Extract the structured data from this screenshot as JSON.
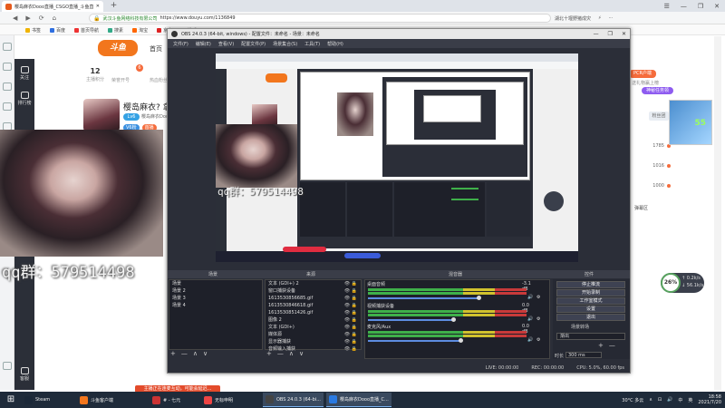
{
  "browser": {
    "tab_title": "樱岛麻衣Dooo直播_CSGO直播_斗鱼直播",
    "new_tab": "+",
    "window_controls": [
      "☰",
      "—",
      "❐",
      "✕"
    ],
    "nav": [
      "◀",
      "▶",
      "⟳",
      "⌂"
    ],
    "url_site": "武汉斗鱼网络科技有限公司",
    "url": "https://www.douyu.com/1136849",
    "right_tools": [
      "湖北十堰野猪成灾",
      "⚡",
      "⋯"
    ],
    "bookmarks": [
      {
        "label": "书签",
        "color": "#f0b400"
      },
      {
        "label": "百度",
        "color": "#2f6fe0"
      },
      {
        "label": "首页导航",
        "color": "#e33"
      },
      {
        "label": "搜素",
        "color": "#3a8"
      },
      {
        "label": "淘宝",
        "color": "#f60"
      },
      {
        "label": "京东",
        "color": "#d22"
      },
      {
        "label": "游戏",
        "color": "#66c"
      }
    ]
  },
  "douyu": {
    "logo": "斗鱼",
    "home": "首页",
    "sidebar": [
      {
        "label": "关注"
      },
      {
        "label": "排行榜"
      },
      {
        "label": "客服"
      }
    ],
    "stats": [
      {
        "value": "12",
        "label": "主播积分"
      },
      {
        "value": "",
        "label": "荣誉开号"
      },
      {
        "value": "",
        "label": "热血粉丝"
      }
    ],
    "stat_badge": "6",
    "streamer_title": "樱岛麻衣? 拿来",
    "level_badge": "Lv6",
    "streamer_name": "樱岛麻衣Dooo",
    "tags": [
      {
        "text": "V6粉",
        "color": "#3b90e0"
      },
      {
        "text": "首播",
        "color": "#f56c3c"
      }
    ],
    "pcr": "PCR户端",
    "gift": "送礼物赢上榜",
    "ad": "神秘任务领",
    "fans": "粉丝团",
    "ranks": [
      "1785",
      "1016",
      "1000"
    ],
    "danmu": "弹幕区"
  },
  "webcam_overlay": "qq群：579514498",
  "obs": {
    "title": "OBS 24.0.3 (64-bit, windows) - 配置文件：未命名 - 场景：未命名",
    "window_controls": [
      "—",
      "❐",
      "✕"
    ],
    "menu": [
      "文件(F)",
      "编辑(E)",
      "查看(V)",
      "配置文件(P)",
      "场景集合(S)",
      "工具(T)",
      "帮助(H)"
    ],
    "preview_overlay": "qq群：579514498",
    "dock_titles": {
      "scenes": "场景",
      "sources": "来源",
      "mixer": "混音器",
      "controls": "控件"
    },
    "scenes": [
      "场景",
      "场景 2",
      "场景 3",
      "场景 4"
    ],
    "sources": [
      "文本 (GDI+) 2",
      "窗口捕获设备",
      "1613530856685.gif",
      "1613530846618.gif",
      "1613530851426.gif",
      "图像 2",
      "文本 (GDI+)",
      "媒体源",
      "显示器捕获",
      "音频输入捕获"
    ],
    "mixer": [
      {
        "name": "桌面音频",
        "db": "-3.1 dB",
        "level": 0.72
      },
      {
        "name": "视频捕获设备",
        "db": "0.0 dB",
        "level": 0.55
      },
      {
        "name": "麦克风/Aux",
        "db": "0.0 dB",
        "level": 0.6
      }
    ],
    "controls": [
      "停止推流",
      "开始录制",
      "工作室模式",
      "设置",
      "退出"
    ],
    "transition_label": "场景转场",
    "transition_value": "渐出",
    "duration_label": "时长",
    "duration_value": "300 ms",
    "dock_tools": [
      "+",
      "—",
      "∧",
      "∨"
    ],
    "status": [
      "LIVE: 00:00:00",
      "REC: 00:00:00",
      "CPU: 5.0%, 60.00 fps"
    ]
  },
  "speed": {
    "percent": "26%",
    "up": "↑ 0.2k/s",
    "down": "↓ 56.1k/s"
  },
  "side_thumb_value": "55",
  "notification": "主播正在连麦互动，可能会延迟...",
  "taskbar": {
    "start": "⊞",
    "apps": [
      {
        "label": "Steam",
        "color": "#1b2838"
      },
      {
        "label": "斗鱼客户端",
        "color": "#f2761d"
      },
      {
        "label": "# - 七元",
        "color": "#c33"
      },
      {
        "label": "无标申明",
        "color": "#e44"
      },
      {
        "label": "OBS 24.0.3 (64-bi...",
        "color": "#444"
      },
      {
        "label": "樱岛麻衣Dooo直播_C...",
        "color": "#2a7ae2"
      }
    ],
    "weather": "30°C 多云",
    "tray": [
      "∧",
      "⊡",
      "🔊",
      "中",
      "英"
    ],
    "time": "18:58",
    "date": "2021/7/20"
  }
}
